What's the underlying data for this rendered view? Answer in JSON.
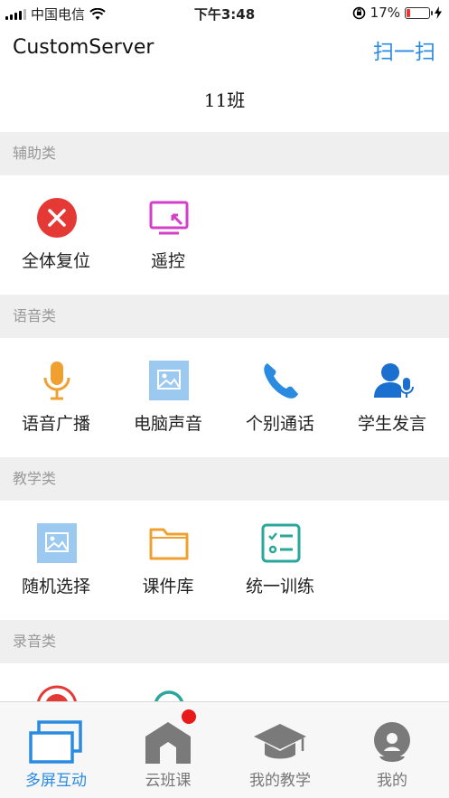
{
  "status_bar": {
    "carrier": "中国电信",
    "time": "下午3:48",
    "battery": "17%",
    "battery_level": 0.17
  },
  "nav": {
    "title": "CustomServer",
    "scan_label": "扫一扫"
  },
  "class_name": "11班",
  "sections": {
    "assist": {
      "title": "辅助类",
      "items": [
        "全体复位",
        "遥控"
      ]
    },
    "voice": {
      "title": "语音类",
      "items": [
        "语音广播",
        "电脑声音",
        "个别通话",
        "学生发言"
      ]
    },
    "teaching": {
      "title": "教学类",
      "items": [
        "随机选择",
        "课件库",
        "统一训练"
      ]
    },
    "recording": {
      "title": "录音类"
    }
  },
  "tabbar": {
    "tabs": [
      "多屏互动",
      "云班课",
      "我的教学",
      "我的"
    ],
    "active": "多屏互动"
  },
  "colors": {
    "accent": "#2a8be0",
    "badge": "#e81a1a",
    "reset_red": "#e53935",
    "orange": "#f0a030",
    "teal": "#2aa79b"
  }
}
